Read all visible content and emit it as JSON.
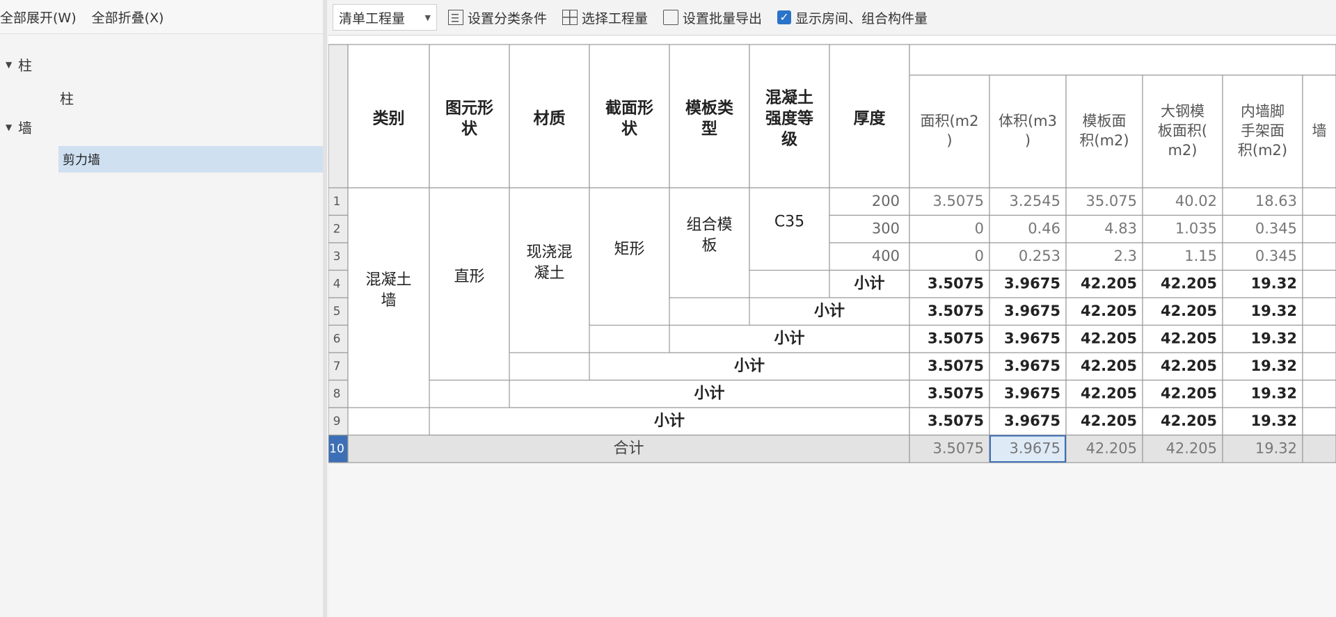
{
  "left_panel": {
    "expand_all": "全部展开(W)",
    "collapse_all": "全部折叠(X)",
    "tree": [
      {
        "label": "柱",
        "children": [
          "柱"
        ]
      },
      {
        "label": "墙",
        "children": [
          "剪力墙"
        ]
      }
    ],
    "selected": "剪力墙"
  },
  "toolbar": {
    "select_value": "清单工程量",
    "set_category": "设置分类条件",
    "select_qty": "选择工程量",
    "batch_export": "设置批量导出",
    "show_rooms": "显示房间、组合构件量",
    "show_rooms_checked": true
  },
  "table": {
    "headers": [
      "类别",
      "图元形状",
      "材质",
      "截面形状",
      "模板类型",
      "混凝土强度等级",
      "厚度",
      "面积(m2)",
      "体积(m3)",
      "模板面积(m2)",
      "大钢模板面积(m2)",
      "内墙脚手架面积(m2)",
      "墙"
    ],
    "header_display": [
      "类别",
      "图元形\n状",
      "材质",
      "截面形\n状",
      "模板类\n型",
      "混凝土\n强度等\n级",
      "厚度",
      "面积(m2\n)",
      "体积(m3\n)",
      "模板面\n积(m2)",
      "大钢模\n板面积(\nm2)",
      "内墙脚\n手架面\n积(m2)",
      "墙"
    ],
    "row_numbers": [
      "1",
      "2",
      "3",
      "4",
      "5",
      "6",
      "7",
      "8",
      "9",
      "10"
    ],
    "category": "混凝土\n墙",
    "shape": "直形",
    "material": "现浇混\n凝土",
    "section": "矩形",
    "formwork": "组合模\n板",
    "grade": "C35",
    "thicknesses": [
      "200",
      "300",
      "400"
    ],
    "subtotal": "小计",
    "total": "合计",
    "detail_rows": [
      [
        "3.5075",
        "3.2545",
        "35.075",
        "40.02",
        "18.63"
      ],
      [
        "0",
        "0.46",
        "4.83",
        "1.035",
        "0.345"
      ],
      [
        "0",
        "0.253",
        "2.3",
        "1.15",
        "0.345"
      ]
    ],
    "subtotal_values": [
      "3.5075",
      "3.9675",
      "42.205",
      "42.205",
      "19.32"
    ],
    "total_values": [
      "3.5075",
      "3.9675",
      "42.205",
      "42.205",
      "19.32"
    ]
  }
}
